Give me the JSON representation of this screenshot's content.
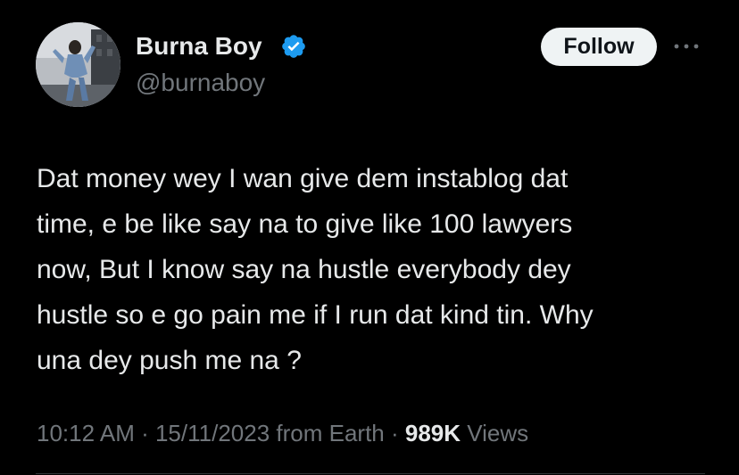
{
  "author": {
    "display_name": "Burna Boy",
    "handle": "@burnaboy",
    "verified_icon": "verified-badge-icon",
    "avatar_icon": "profile-photo"
  },
  "actions": {
    "follow_label": "Follow",
    "more_icon": "more-options-icon"
  },
  "tweet": {
    "lines": [
      "Dat money wey I wan give dem instablog dat",
      "time, e be like say na to give like 100 lawyers",
      "now, But I know say na hustle everybody dey",
      "hustle so e go pain me if I run dat kind tin. Why",
      "una dey push me na ?"
    ]
  },
  "meta": {
    "time": "10:12 AM",
    "separator_1": " · ",
    "date": "15/11/2023",
    "source": " from Earth",
    "separator_2": " · ",
    "views_count": "989K",
    "views_label": " Views"
  },
  "colors": {
    "background": "#000000",
    "primary_text": "#e7e9ea",
    "secondary_text": "#71767b",
    "verified_blue": "#1d9bf0",
    "follow_bg": "#eff3f4",
    "divider": "#2f3336"
  }
}
